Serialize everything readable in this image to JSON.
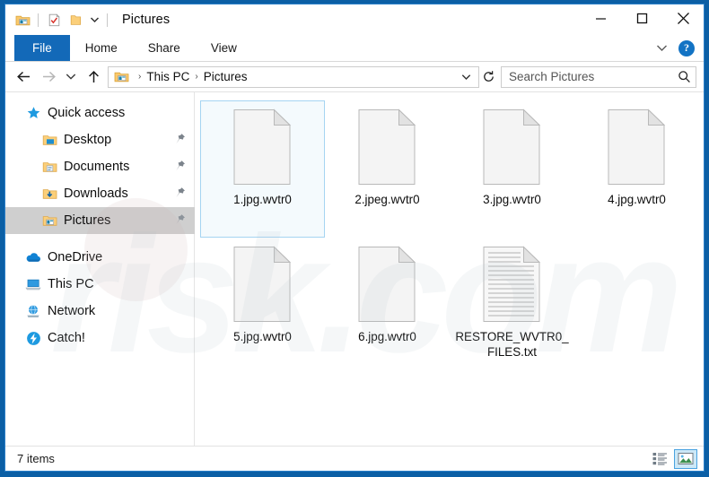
{
  "window": {
    "title": "Pictures",
    "colors": {
      "frame_blue": "#0b5fa5",
      "file_tab_blue": "#1369b8",
      "selection_blue": "#a5d4f2",
      "sidebar_selected_gray": "#cfcfcf",
      "help_blue": "#1273c4"
    },
    "quick_access_toolbar": [
      {
        "name": "properties-icon",
        "label": "Properties"
      },
      {
        "name": "new-folder-checkbox-icon",
        "label": "Undo"
      },
      {
        "name": "folder-icon",
        "label": "New folder"
      },
      {
        "name": "customize-chevron-icon",
        "label": "Customize Quick Access Toolbar"
      }
    ],
    "controls": [
      {
        "name": "minimize-button",
        "label": "Minimize"
      },
      {
        "name": "maximize-button",
        "label": "Maximize"
      },
      {
        "name": "close-button",
        "label": "Close"
      }
    ]
  },
  "ribbon": {
    "tabs": [
      {
        "label": "File",
        "active": true
      },
      {
        "label": "Home",
        "active": false
      },
      {
        "label": "Share",
        "active": false
      },
      {
        "label": "View",
        "active": false
      }
    ],
    "collapse_label": "⌄",
    "help_label": "?"
  },
  "address": {
    "back_label": "Back",
    "forward_label": "Forward",
    "recent_label": "Recent locations",
    "up_label": "Up",
    "breadcrumbs": [
      "This PC",
      "Pictures"
    ],
    "separator": "›",
    "dropdown_label": "⌄",
    "refresh_label": "↻"
  },
  "search": {
    "placeholder": "Search Pictures",
    "value": ""
  },
  "sidebar": {
    "items": [
      {
        "label": "Quick access",
        "icon": "star-icon",
        "level": 0,
        "pinned": false,
        "selected": false
      },
      {
        "label": "Desktop",
        "icon": "folder-desktop-icon",
        "level": 1,
        "pinned": true,
        "selected": false
      },
      {
        "label": "Documents",
        "icon": "folder-documents-icon",
        "level": 1,
        "pinned": true,
        "selected": false
      },
      {
        "label": "Downloads",
        "icon": "folder-downloads-icon",
        "level": 1,
        "pinned": true,
        "selected": false
      },
      {
        "label": "Pictures",
        "icon": "folder-pictures-icon",
        "level": 1,
        "pinned": true,
        "selected": true
      },
      {
        "label": "OneDrive",
        "icon": "cloud-icon",
        "level": 0,
        "pinned": false,
        "selected": false
      },
      {
        "label": "This PC",
        "icon": "computer-icon",
        "level": 0,
        "pinned": false,
        "selected": false
      },
      {
        "label": "Network",
        "icon": "network-icon",
        "level": 0,
        "pinned": false,
        "selected": false
      },
      {
        "label": "Catch!",
        "icon": "catch-lightning-icon",
        "level": 0,
        "pinned": false,
        "selected": false
      }
    ]
  },
  "files": [
    {
      "name": "1.jpg.wvtr0",
      "type": "blank-document",
      "selected": true
    },
    {
      "name": "2.jpeg.wvtr0",
      "type": "blank-document",
      "selected": false
    },
    {
      "name": "3.jpg.wvtr0",
      "type": "blank-document",
      "selected": false
    },
    {
      "name": "4.jpg.wvtr0",
      "type": "blank-document",
      "selected": false
    },
    {
      "name": "5.jpg.wvtr0",
      "type": "blank-document",
      "selected": false
    },
    {
      "name": "6.jpg.wvtr0",
      "type": "blank-document",
      "selected": false
    },
    {
      "name": "RESTORE_WVTR0_FILES.txt",
      "type": "text-document",
      "selected": false
    }
  ],
  "status": {
    "item_count_text": "7 items",
    "view_buttons": [
      {
        "name": "details-view-button",
        "label": "Details view",
        "active": false
      },
      {
        "name": "large-icons-view-button",
        "label": "Large icons view",
        "active": true
      }
    ]
  },
  "watermark": {
    "text": "risk.com"
  }
}
